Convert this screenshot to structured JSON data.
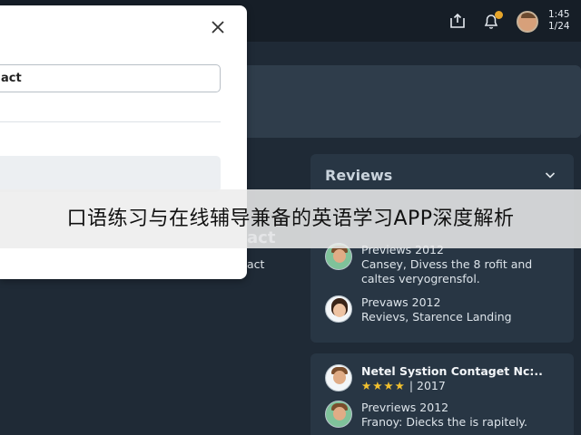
{
  "header": {
    "time": "1:45",
    "date": "1/24"
  },
  "icons": {
    "upload": "upload-icon",
    "notification": "bell-icon",
    "close": "close-icon",
    "collapse": "chevron-down-icon"
  },
  "colors": {
    "background": "#1f2a36",
    "topbar": "#161e27",
    "panel": "#283644",
    "modal": "#ffffff",
    "notification_dot": "#e6a52a",
    "stars": "#f2c12e"
  },
  "modal": {
    "input_value": "act"
  },
  "background_card": {
    "title": "act",
    "subtitle": "act"
  },
  "reviews": {
    "title": "Reviews",
    "items": [
      {
        "line1": "Previews 2012",
        "line2": "Cansey, Divess the 8 rofit and",
        "line3": "caltes veryogrensfol."
      },
      {
        "line1": "Prevaws 2012",
        "line2": "Revievs, Starence Landing"
      }
    ]
  },
  "reviews2": {
    "items": [
      {
        "name": "Netel Systion Contaget Nc:..",
        "stars": "★★★★",
        "rating_suffix": "| 2017"
      },
      {
        "line1": "Prevriews 2012",
        "line2": "Franoy: Diecks the is rapitely."
      }
    ]
  },
  "overlay": {
    "text": "口语练习与在线辅导兼备的英语学习APP深度解析"
  }
}
